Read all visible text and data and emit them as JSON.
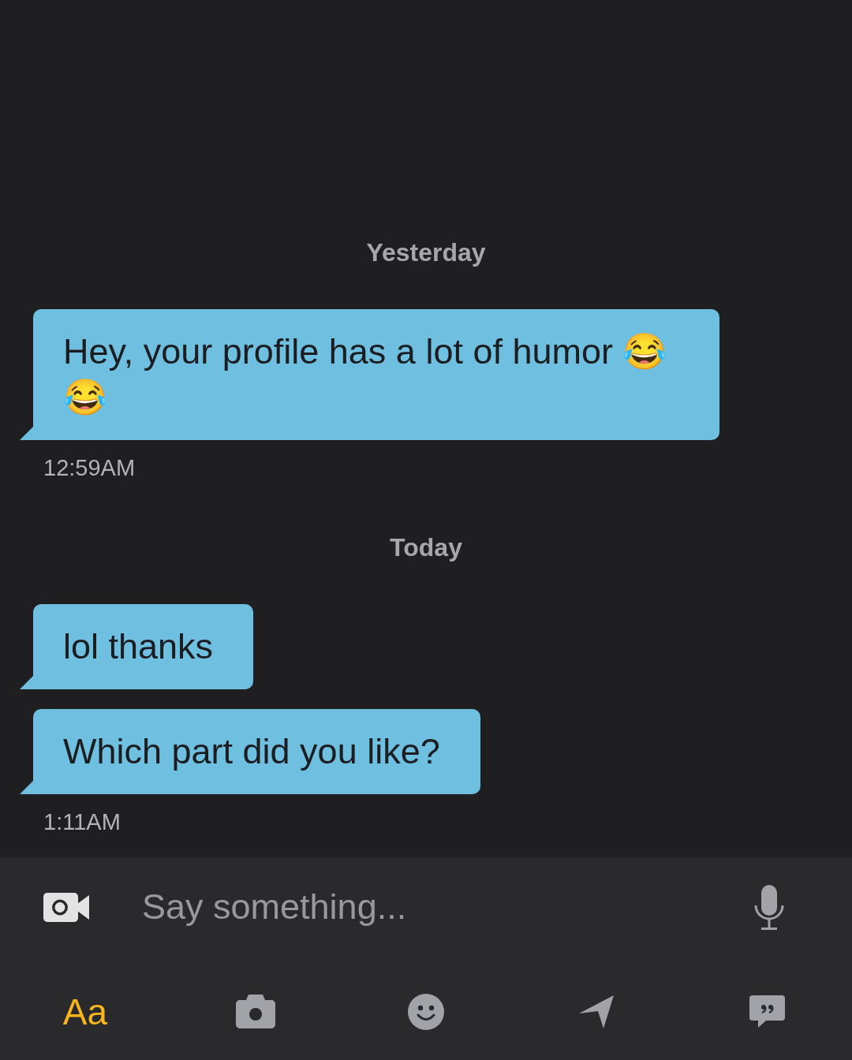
{
  "conversation": [
    {
      "date": "Yesterday",
      "messages": [
        {
          "text": "Hey, your profile has a lot of humor 😂😂"
        }
      ],
      "time": "12:59AM"
    },
    {
      "date": "Today",
      "messages": [
        {
          "text": "lol thanks"
        },
        {
          "text": "Which part did you like?"
        }
      ],
      "time": "1:11AM"
    }
  ],
  "composer": {
    "placeholder": "Say something..."
  },
  "toolbar": [
    {
      "kind": "text",
      "label": "Aa",
      "selected": true
    },
    {
      "kind": "camera",
      "selected": false
    },
    {
      "kind": "smiley",
      "selected": false
    },
    {
      "kind": "location",
      "selected": false
    },
    {
      "kind": "phrases",
      "selected": false
    }
  ]
}
